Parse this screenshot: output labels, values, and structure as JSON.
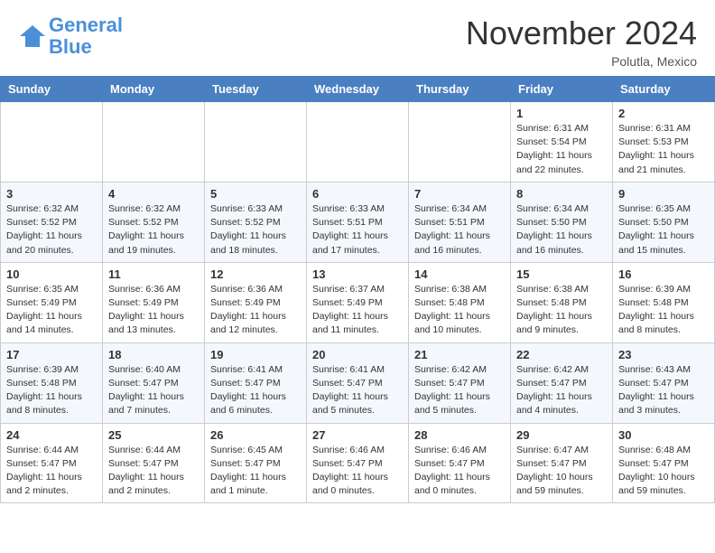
{
  "header": {
    "logo_line1": "General",
    "logo_line2": "Blue",
    "month": "November 2024",
    "location": "Polutla, Mexico"
  },
  "days_of_week": [
    "Sunday",
    "Monday",
    "Tuesday",
    "Wednesday",
    "Thursday",
    "Friday",
    "Saturday"
  ],
  "weeks": [
    [
      {
        "day": "",
        "info": ""
      },
      {
        "day": "",
        "info": ""
      },
      {
        "day": "",
        "info": ""
      },
      {
        "day": "",
        "info": ""
      },
      {
        "day": "",
        "info": ""
      },
      {
        "day": "1",
        "info": "Sunrise: 6:31 AM\nSunset: 5:54 PM\nDaylight: 11 hours\nand 22 minutes."
      },
      {
        "day": "2",
        "info": "Sunrise: 6:31 AM\nSunset: 5:53 PM\nDaylight: 11 hours\nand 21 minutes."
      }
    ],
    [
      {
        "day": "3",
        "info": "Sunrise: 6:32 AM\nSunset: 5:52 PM\nDaylight: 11 hours\nand 20 minutes."
      },
      {
        "day": "4",
        "info": "Sunrise: 6:32 AM\nSunset: 5:52 PM\nDaylight: 11 hours\nand 19 minutes."
      },
      {
        "day": "5",
        "info": "Sunrise: 6:33 AM\nSunset: 5:52 PM\nDaylight: 11 hours\nand 18 minutes."
      },
      {
        "day": "6",
        "info": "Sunrise: 6:33 AM\nSunset: 5:51 PM\nDaylight: 11 hours\nand 17 minutes."
      },
      {
        "day": "7",
        "info": "Sunrise: 6:34 AM\nSunset: 5:51 PM\nDaylight: 11 hours\nand 16 minutes."
      },
      {
        "day": "8",
        "info": "Sunrise: 6:34 AM\nSunset: 5:50 PM\nDaylight: 11 hours\nand 16 minutes."
      },
      {
        "day": "9",
        "info": "Sunrise: 6:35 AM\nSunset: 5:50 PM\nDaylight: 11 hours\nand 15 minutes."
      }
    ],
    [
      {
        "day": "10",
        "info": "Sunrise: 6:35 AM\nSunset: 5:49 PM\nDaylight: 11 hours\nand 14 minutes."
      },
      {
        "day": "11",
        "info": "Sunrise: 6:36 AM\nSunset: 5:49 PM\nDaylight: 11 hours\nand 13 minutes."
      },
      {
        "day": "12",
        "info": "Sunrise: 6:36 AM\nSunset: 5:49 PM\nDaylight: 11 hours\nand 12 minutes."
      },
      {
        "day": "13",
        "info": "Sunrise: 6:37 AM\nSunset: 5:49 PM\nDaylight: 11 hours\nand 11 minutes."
      },
      {
        "day": "14",
        "info": "Sunrise: 6:38 AM\nSunset: 5:48 PM\nDaylight: 11 hours\nand 10 minutes."
      },
      {
        "day": "15",
        "info": "Sunrise: 6:38 AM\nSunset: 5:48 PM\nDaylight: 11 hours\nand 9 minutes."
      },
      {
        "day": "16",
        "info": "Sunrise: 6:39 AM\nSunset: 5:48 PM\nDaylight: 11 hours\nand 8 minutes."
      }
    ],
    [
      {
        "day": "17",
        "info": "Sunrise: 6:39 AM\nSunset: 5:48 PM\nDaylight: 11 hours\nand 8 minutes."
      },
      {
        "day": "18",
        "info": "Sunrise: 6:40 AM\nSunset: 5:47 PM\nDaylight: 11 hours\nand 7 minutes."
      },
      {
        "day": "19",
        "info": "Sunrise: 6:41 AM\nSunset: 5:47 PM\nDaylight: 11 hours\nand 6 minutes."
      },
      {
        "day": "20",
        "info": "Sunrise: 6:41 AM\nSunset: 5:47 PM\nDaylight: 11 hours\nand 5 minutes."
      },
      {
        "day": "21",
        "info": "Sunrise: 6:42 AM\nSunset: 5:47 PM\nDaylight: 11 hours\nand 5 minutes."
      },
      {
        "day": "22",
        "info": "Sunrise: 6:42 AM\nSunset: 5:47 PM\nDaylight: 11 hours\nand 4 minutes."
      },
      {
        "day": "23",
        "info": "Sunrise: 6:43 AM\nSunset: 5:47 PM\nDaylight: 11 hours\nand 3 minutes."
      }
    ],
    [
      {
        "day": "24",
        "info": "Sunrise: 6:44 AM\nSunset: 5:47 PM\nDaylight: 11 hours\nand 2 minutes."
      },
      {
        "day": "25",
        "info": "Sunrise: 6:44 AM\nSunset: 5:47 PM\nDaylight: 11 hours\nand 2 minutes."
      },
      {
        "day": "26",
        "info": "Sunrise: 6:45 AM\nSunset: 5:47 PM\nDaylight: 11 hours\nand 1 minute."
      },
      {
        "day": "27",
        "info": "Sunrise: 6:46 AM\nSunset: 5:47 PM\nDaylight: 11 hours\nand 0 minutes."
      },
      {
        "day": "28",
        "info": "Sunrise: 6:46 AM\nSunset: 5:47 PM\nDaylight: 11 hours\nand 0 minutes."
      },
      {
        "day": "29",
        "info": "Sunrise: 6:47 AM\nSunset: 5:47 PM\nDaylight: 10 hours\nand 59 minutes."
      },
      {
        "day": "30",
        "info": "Sunrise: 6:48 AM\nSunset: 5:47 PM\nDaylight: 10 hours\nand 59 minutes."
      }
    ]
  ]
}
